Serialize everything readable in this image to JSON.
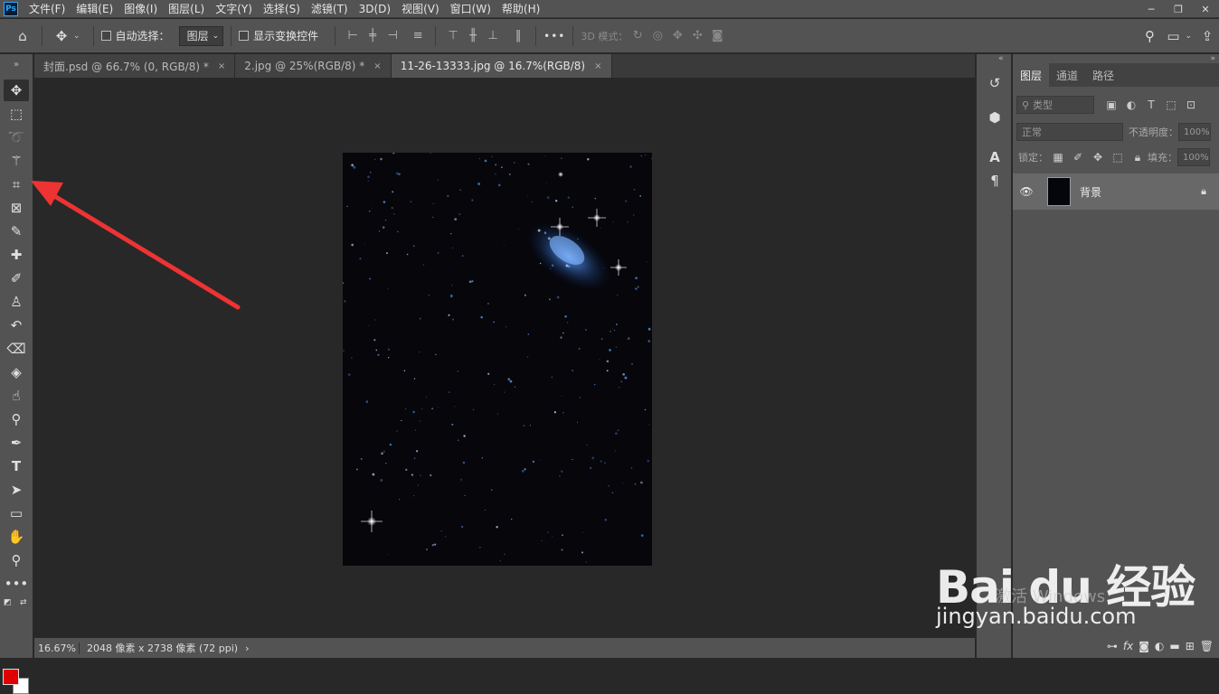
{
  "menubar": {
    "logo": "Ps",
    "items": [
      "文件(F)",
      "编辑(E)",
      "图像(I)",
      "图层(L)",
      "文字(Y)",
      "选择(S)",
      "滤镜(T)",
      "3D(D)",
      "视图(V)",
      "窗口(W)",
      "帮助(H)"
    ]
  },
  "optbar": {
    "auto_select_label": "自动选择：",
    "auto_select_value": "图层",
    "show_transform_label": "显示变换控件",
    "more": "•••",
    "mode_3d_label": "3D 模式："
  },
  "tabs": [
    {
      "label": "封面.psd @ 66.7% (0, RGB/8) *",
      "close": "×"
    },
    {
      "label": "2.jpg @ 25%(RGB/8) *",
      "close": "×"
    },
    {
      "label": "11-26-13333.jpg @ 16.7%(RGB/8)",
      "close": "×"
    }
  ],
  "statusbar": {
    "zoom": "16.67%",
    "info": "2048 像素 x 2738 像素 (72 ppi)",
    "arrow": "›"
  },
  "layers_panel": {
    "tabs": [
      "图层",
      "通道",
      "路径"
    ],
    "filter_placeholder": "类型",
    "blend_mode": "正常",
    "opacity_label": "不透明度：",
    "opacity_value": "100%",
    "lock_label": "锁定：",
    "fill_label": "填充：",
    "fill_value": "100%",
    "layer_name": "背景"
  },
  "watermark": {
    "logo_text": "Bai du 经验",
    "site": "jingyan.baidu.com",
    "activate": "激活 Windows"
  },
  "colors": {
    "foreground": "#e00000",
    "background": "#ffffff",
    "arrow": "#ee3333"
  }
}
